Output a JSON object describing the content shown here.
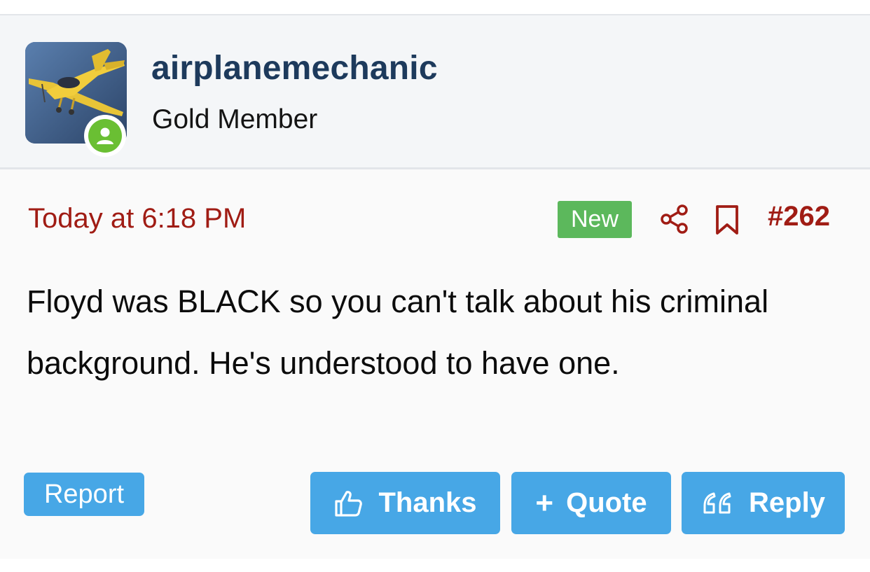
{
  "user": {
    "username": "airplanemechanic",
    "title": "Gold Member",
    "avatar_icon": "airplane-avatar",
    "online": true
  },
  "post": {
    "date": "Today at 6:18 PM",
    "new_badge": "New",
    "number": "#262",
    "body": "Floyd was BLACK so you can't talk about his criminal background. He's understood to have one."
  },
  "actions": {
    "report_label": "Report",
    "thanks_label": "Thanks",
    "quote_label": "Quote",
    "reply_label": "Reply"
  },
  "colors": {
    "username": "#1d3a5c",
    "date_and_number": "#a01c14",
    "new_badge": "#5cb85c",
    "buttons": "#47a7e6",
    "online_dot": "#6abf33"
  }
}
